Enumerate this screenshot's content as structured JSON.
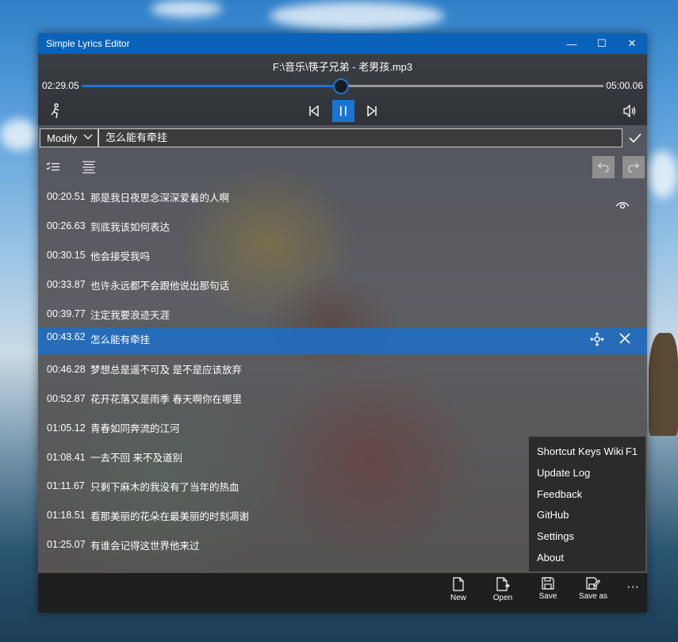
{
  "window": {
    "title": "Simple Lyrics Editor",
    "minimize": "—",
    "maximize": "☐",
    "close": "✕"
  },
  "player": {
    "filename": "F:\\音乐\\筷子兄弟 - 老男孩.mp3",
    "current_time": "02:29.05",
    "total_time": "05:00.06",
    "progress": 0.497
  },
  "editor": {
    "mode": "Modify",
    "input_value": "怎么能有牵挂"
  },
  "lyrics": [
    {
      "time": "00:20.51",
      "text": "那是我日夜思念深深爱着的人啊"
    },
    {
      "time": "00:26.63",
      "text": "到底我该如何表达"
    },
    {
      "time": "00:30.15",
      "text": "他会接受我吗"
    },
    {
      "time": "00:33.87",
      "text": "也许永远都不会跟他说出那句话"
    },
    {
      "time": "00:39.77",
      "text": "注定我要浪迹天涯"
    },
    {
      "time": "00:43.62",
      "text": "怎么能有牵挂"
    },
    {
      "time": "00:46.28",
      "text": "梦想总是遥不可及 是不是应该放弃"
    },
    {
      "time": "00:52.87",
      "text": "花开花落又是雨季 春天啊你在哪里"
    },
    {
      "time": "01:05.12",
      "text": "青春如同奔流的江河"
    },
    {
      "time": "01:08.41",
      "text": "一去不回 来不及道别"
    },
    {
      "time": "01:11.67",
      "text": "只剩下麻木的我没有了当年的热血"
    },
    {
      "time": "01:18.51",
      "text": "看那美丽的花朵在最美丽的时刻凋谢"
    },
    {
      "time": "01:25.07",
      "text": "有谁会记得这世界他来过"
    }
  ],
  "selected_index": 5,
  "commands": {
    "new": "New",
    "open": "Open",
    "save": "Save",
    "save_as": "Save as",
    "more": "···"
  },
  "menu": {
    "items": [
      {
        "label": "Shortcut Keys Wiki",
        "key": "F1"
      },
      {
        "label": "Update Log",
        "key": ""
      },
      {
        "label": "Feedback",
        "key": ""
      },
      {
        "label": "GitHub",
        "key": ""
      },
      {
        "label": "Settings",
        "key": ""
      },
      {
        "label": "About",
        "key": ""
      }
    ]
  },
  "colors": {
    "accent": "#1c74d2",
    "titlebar": "#0a63b8"
  }
}
